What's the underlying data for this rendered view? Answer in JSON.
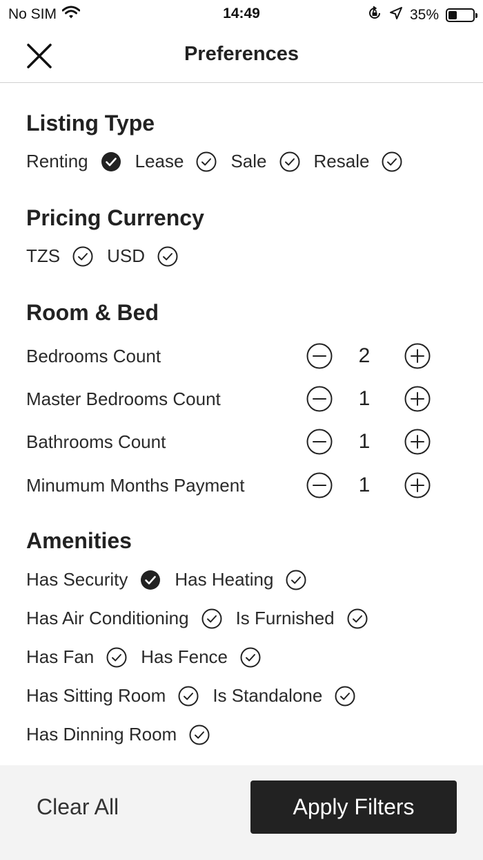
{
  "status_bar": {
    "carrier": "No SIM",
    "time": "14:49",
    "battery": "35%",
    "battery_level": 0.35
  },
  "nav": {
    "title": "Preferences"
  },
  "listing_type": {
    "title": "Listing Type",
    "options": [
      {
        "label": "Renting",
        "selected": true
      },
      {
        "label": "Lease",
        "selected": false
      },
      {
        "label": "Sale",
        "selected": false
      },
      {
        "label": "Resale",
        "selected": false
      }
    ]
  },
  "pricing_currency": {
    "title": "Pricing Currency",
    "options": [
      {
        "label": "TZS",
        "selected": false
      },
      {
        "label": "USD",
        "selected": false
      }
    ]
  },
  "room_bed": {
    "title": "Room & Bed",
    "counters": [
      {
        "label": "Bedrooms Count",
        "value": "2"
      },
      {
        "label": "Master Bedrooms Count",
        "value": "1"
      },
      {
        "label": "Bathrooms Count",
        "value": "1"
      },
      {
        "label": "Minumum Months Payment",
        "value": "1"
      }
    ]
  },
  "amenities": {
    "title": "Amenities",
    "options": [
      {
        "label": "Has Security",
        "selected": true
      },
      {
        "label": "Has Heating",
        "selected": false
      },
      {
        "label": "Has Air Conditioning",
        "selected": false
      },
      {
        "label": "Is Furnished",
        "selected": false
      },
      {
        "label": "Has Fan",
        "selected": false
      },
      {
        "label": "Has Fence",
        "selected": false
      },
      {
        "label": "Has Sitting Room",
        "selected": false
      },
      {
        "label": "Is Standalone",
        "selected": false
      },
      {
        "label": "Has Dinning Room",
        "selected": false
      }
    ]
  },
  "footer": {
    "clear_label": "Clear All",
    "apply_label": "Apply Filters"
  },
  "colors": {
    "primary_dark": "#222222",
    "footer_bg": "#f3f3f3",
    "divider": "#d0d0d0"
  }
}
